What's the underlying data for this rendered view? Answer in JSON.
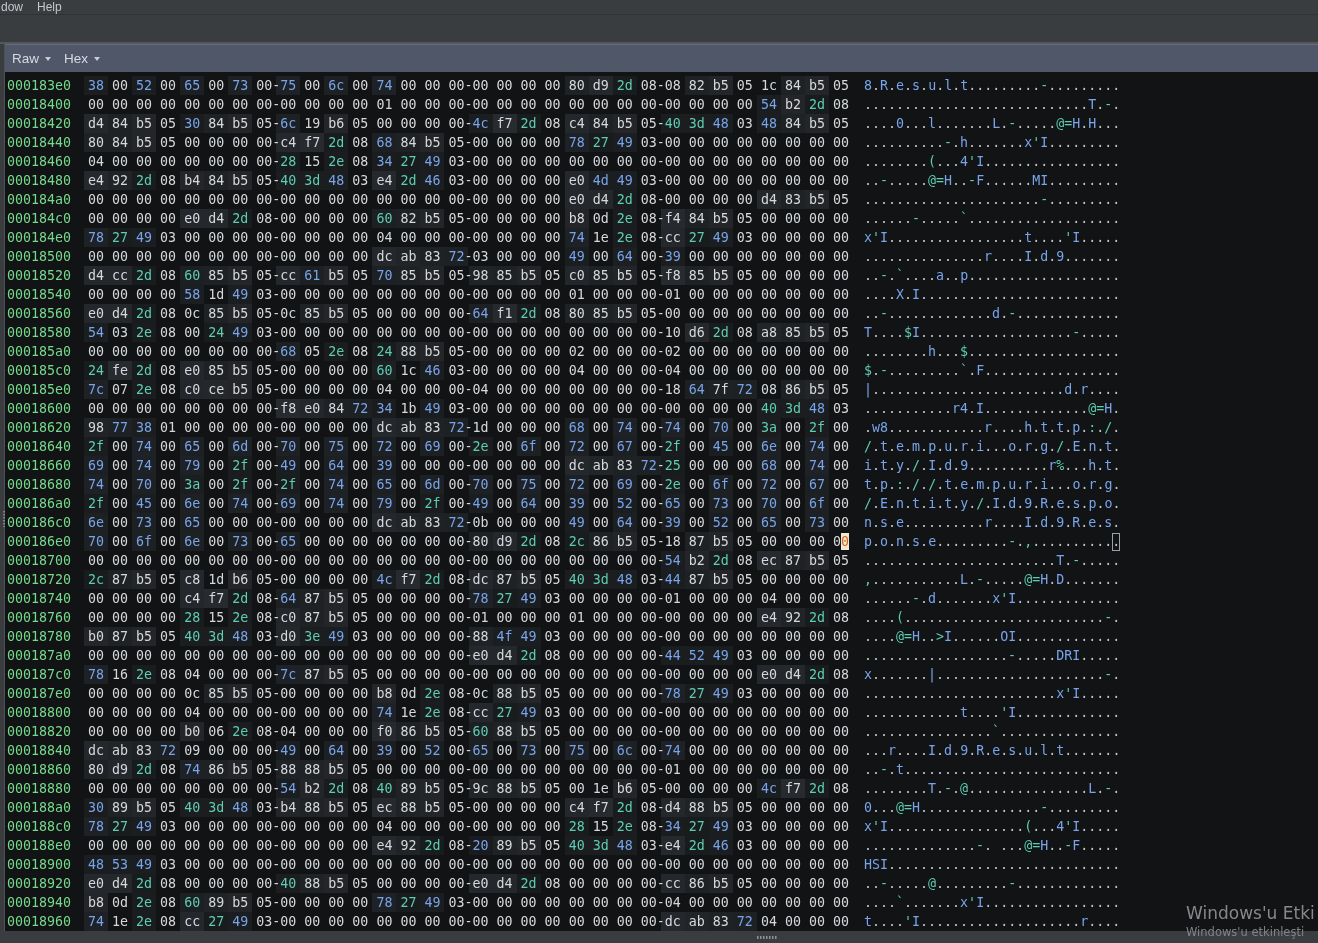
{
  "menu_bar": {
    "items": [
      {
        "label": "dow"
      },
      {
        "label": "Help"
      }
    ]
  },
  "view_toolbar": {
    "dropdowns": [
      {
        "label": "Raw"
      },
      {
        "label": "Hex"
      }
    ]
  },
  "hex_view": {
    "rows": [
      {
        "address": "000183e0",
        "hex": "38 00 52 00 65 00 73 00-75 00 6c 00 74 00 00 00-00 00 00 00 80 d9 2d 08-08 82 b5 05 1c 84 b5 05",
        "ascii": "8.R.e.s.u.l.t.........-.........",
        "cursor": false
      },
      {
        "address": "00018400",
        "hex": "00 00 00 00 00 00 00 00-00 00 00 00 01 00 00 00-00 00 00 00 00 00 00 00-00 00 00 00 54 b2 2d 08",
        "ascii": "............................T.-.",
        "cursor": false
      },
      {
        "address": "00018420",
        "hex": "d4 84 b5 05 30 84 b5 05-6c 19 b6 05 00 00 00 00-4c f7 2d 08 c4 84 b5 05-40 3d 48 03 48 84 b5 05",
        "ascii": "....0...l.......L.-.....@=H.H...",
        "cursor": false
      },
      {
        "address": "00018440",
        "hex": "80 84 b5 05 00 00 00 00-c4 f7 2d 08 68 84 b5 05-00 00 00 00 78 27 49 03-00 00 00 00 00 00 00 00",
        "ascii": "..........-.h.......x'I.........",
        "cursor": false
      },
      {
        "address": "00018460",
        "hex": "04 00 00 00 00 00 00 00-28 15 2e 08 34 27 49 03-00 00 00 00 00 00 00 00-00 00 00 00 00 00 00 00",
        "ascii": "........(...4'I.................",
        "cursor": false
      },
      {
        "address": "00018480",
        "hex": "e4 92 2d 08 b4 84 b5 05-40 3d 48 03 e4 2d 46 03-00 00 00 00 e0 4d 49 03-00 00 00 00 00 00 00 00",
        "ascii": "..-.....@=H..-F......MI.........",
        "cursor": false
      },
      {
        "address": "000184a0",
        "hex": "00 00 00 00 00 00 00 00-00 00 00 00 00 00 00 00-00 00 00 00 e0 d4 2d 08-00 00 00 00 d4 83 b5 05",
        "ascii": "......................-.........",
        "cursor": false
      },
      {
        "address": "000184c0",
        "hex": "00 00 00 00 e0 d4 2d 08-00 00 00 00 60 82 b5 05-00 00 00 00 b8 0d 2e 08-f4 84 b5 05 00 00 00 00",
        "ascii": "......-.....`...................",
        "cursor": false
      },
      {
        "address": "000184e0",
        "hex": "78 27 49 03 00 00 00 00-00 00 00 00 04 00 00 00-00 00 00 00 74 1e 2e 08-cc 27 49 03 00 00 00 00",
        "ascii": "x'I.................t....'I.....",
        "cursor": false
      },
      {
        "address": "00018500",
        "hex": "00 00 00 00 00 00 00 00-00 00 00 00 dc ab 83 72-03 00 00 00 49 00 64 00-39 00 00 00 00 00 00 00",
        "ascii": "...............r....I.d.9.......",
        "cursor": false
      },
      {
        "address": "00018520",
        "hex": "d4 cc 2d 08 60 85 b5 05-cc 61 b5 05 70 85 b5 05-98 85 b5 05 c0 85 b5 05-f8 85 b5 05 00 00 00 00",
        "ascii": "..-.`....a..p...................",
        "cursor": false
      },
      {
        "address": "00018540",
        "hex": "00 00 00 00 58 1d 49 03-00 00 00 00 00 00 00 00-00 00 00 00 01 00 00 00-01 00 00 00 00 00 00 00",
        "ascii": "....X.I.........................",
        "cursor": false
      },
      {
        "address": "00018560",
        "hex": "e0 d4 2d 08 0c 85 b5 05-0c 85 b5 05 00 00 00 00-64 f1 2d 08 80 85 b5 05-00 00 00 00 00 00 00 00",
        "ascii": "..-.............d.-.............",
        "cursor": false
      },
      {
        "address": "00018580",
        "hex": "54 03 2e 08 00 24 49 03-00 00 00 00 00 00 00 00-00 00 00 00 00 00 00 00-10 d6 2d 08 a8 85 b5 05",
        "ascii": "T....$I...................-.....",
        "cursor": false
      },
      {
        "address": "000185a0",
        "hex": "00 00 00 00 00 00 00 00-68 05 2e 08 24 88 b5 05-00 00 00 00 02 00 00 00-02 00 00 00 00 00 00 00",
        "ascii": "........h...$...................",
        "cursor": false
      },
      {
        "address": "000185c0",
        "hex": "24 fe 2d 08 e0 85 b5 05-00 00 00 00 60 1c 46 03-00 00 00 00 04 00 00 00-04 00 00 00 00 00 00 00",
        "ascii": "$.-.........`.F.................",
        "cursor": false
      },
      {
        "address": "000185e0",
        "hex": "7c 07 2e 08 c0 ce b5 05-00 00 00 00 04 00 00 00-04 00 00 00 00 00 00 00-18 64 7f 72 08 86 b5 05",
        "ascii": "|........................d.r....",
        "cursor": false
      },
      {
        "address": "00018600",
        "hex": "00 00 00 00 00 00 00 00-f8 e0 84 72 34 1b 49 03-00 00 00 00 00 00 00 00-00 00 00 00 40 3d 48 03",
        "ascii": "...........r4.I.............@=H.",
        "cursor": false
      },
      {
        "address": "00018620",
        "hex": "98 77 38 01 00 00 00 00-00 00 00 00 dc ab 83 72-1d 00 00 00 68 00 74 00-74 00 70 00 3a 00 2f 00",
        "ascii": ".w8............r....h.t.t.p.:./.",
        "cursor": false
      },
      {
        "address": "00018640",
        "hex": "2f 00 74 00 65 00 6d 00-70 00 75 00 72 00 69 00-2e 00 6f 00 72 00 67 00-2f 00 45 00 6e 00 74 00",
        "ascii": "/.t.e.m.p.u.r.i...o.r.g./.E.n.t.",
        "cursor": false
      },
      {
        "address": "00018660",
        "hex": "69 00 74 00 79 00 2f 00-49 00 64 00 39 00 00 00-00 00 00 00 dc ab 83 72-25 00 00 00 68 00 74 00",
        "ascii": "i.t.y./.I.d.9..........r%...h.t.",
        "cursor": false
      },
      {
        "address": "00018680",
        "hex": "74 00 70 00 3a 00 2f 00-2f 00 74 00 65 00 6d 00-70 00 75 00 72 00 69 00-2e 00 6f 00 72 00 67 00",
        "ascii": "t.p.:././.t.e.m.p.u.r.i...o.r.g.",
        "cursor": false
      },
      {
        "address": "000186a0",
        "hex": "2f 00 45 00 6e 00 74 00-69 00 74 00 79 00 2f 00-49 00 64 00 39 00 52 00-65 00 73 00 70 00 6f 00",
        "ascii": "/.E.n.t.i.t.y./.I.d.9.R.e.s.p.o.",
        "cursor": false
      },
      {
        "address": "000186c0",
        "hex": "6e 00 73 00 65 00 00 00-00 00 00 00 dc ab 83 72-0b 00 00 00 49 00 64 00-39 00 52 00 65 00 73 00",
        "ascii": "n.s.e..........r....I.d.9.R.e.s.",
        "cursor": false
      },
      {
        "address": "000186e0",
        "hex": "70 00 6f 00 6e 00 73 00-65 00 00 00 00 00 00 00-80 d9 2d 08 2c 86 b5 05-18 87 b5 05 00 00 00 00",
        "ascii": "p.o.n.s.e.........-.,...........",
        "cursor": true
      },
      {
        "address": "00018700",
        "hex": "00 00 00 00 00 00 00 00-00 00 00 00 00 00 00 00-00 00 00 00 00 00 00 00-54 b2 2d 08 ec 87 b5 05",
        "ascii": "........................T.-.....",
        "cursor": false
      },
      {
        "address": "00018720",
        "hex": "2c 87 b5 05 c8 1d b6 05-00 00 00 00 4c f7 2d 08-dc 87 b5 05 40 3d 48 03-44 87 b5 05 00 00 00 00",
        "ascii": ",...........L.-.....@=H.D.......",
        "cursor": false
      },
      {
        "address": "00018740",
        "hex": "00 00 00 00 c4 f7 2d 08-64 87 b5 05 00 00 00 00-78 27 49 03 00 00 00 00-01 00 00 00 04 00 00 00",
        "ascii": "......-.d.......x'I.............",
        "cursor": false
      },
      {
        "address": "00018760",
        "hex": "00 00 00 00 28 15 2e 08-c0 87 b5 05 00 00 00 00-01 00 00 00 01 00 00 00-00 00 00 00 e4 92 2d 08",
        "ascii": "....(.........................-.",
        "cursor": false
      },
      {
        "address": "00018780",
        "hex": "b0 87 b5 05 40 3d 48 03-d0 3e 49 03 00 00 00 00-88 4f 49 03 00 00 00 00-00 00 00 00 00 00 00 00",
        "ascii": "....@=H..>I......OI.............",
        "cursor": false
      },
      {
        "address": "000187a0",
        "hex": "00 00 00 00 00 00 00 00-00 00 00 00 00 00 00 00-e0 d4 2d 08 00 00 00 00-44 52 49 03 00 00 00 00",
        "ascii": "..................-.....DRI.....",
        "cursor": false
      },
      {
        "address": "000187c0",
        "hex": "78 16 2e 08 04 00 00 00-7c 87 b5 05 00 00 00 00-00 00 00 00 00 00 00 00-00 00 00 00 e0 d4 2d 08",
        "ascii": "x.......|.....................-.",
        "cursor": false
      },
      {
        "address": "000187e0",
        "hex": "00 00 00 00 0c 85 b5 05-00 00 00 00 b8 0d 2e 08-0c 88 b5 05 00 00 00 00-78 27 49 03 00 00 00 00",
        "ascii": "........................x'I.....",
        "cursor": false
      },
      {
        "address": "00018800",
        "hex": "00 00 00 00 04 00 00 00-00 00 00 00 74 1e 2e 08-cc 27 49 03 00 00 00 00-00 00 00 00 00 00 00 00",
        "ascii": "............t....'I.............",
        "cursor": false
      },
      {
        "address": "00018820",
        "hex": "00 00 00 00 b0 06 2e 08-04 00 00 00 f0 86 b5 05-60 88 b5 05 00 00 00 00-00 00 00 00 00 00 00 00",
        "ascii": "................`...............",
        "cursor": false
      },
      {
        "address": "00018840",
        "hex": "dc ab 83 72 09 00 00 00-49 00 64 00 39 00 52 00-65 00 73 00 75 00 6c 00-74 00 00 00 00 00 00 00",
        "ascii": "...r....I.d.9.R.e.s.u.l.t.......",
        "cursor": false
      },
      {
        "address": "00018860",
        "hex": "80 d9 2d 08 74 86 b5 05-88 88 b5 05 00 00 00 00-00 00 00 00 00 00 00 00-01 00 00 00 00 00 00 00",
        "ascii": "..-.t...........................",
        "cursor": false
      },
      {
        "address": "00018880",
        "hex": "00 00 00 00 00 00 00 00-54 b2 2d 08 40 89 b5 05-9c 88 b5 05 00 1e b6 05-00 00 00 00 4c f7 2d 08",
        "ascii": "........T.-.@...............L.-.",
        "cursor": false
      },
      {
        "address": "000188a0",
        "hex": "30 89 b5 05 40 3d 48 03-b4 88 b5 05 ec 88 b5 05-00 00 00 00 c4 f7 2d 08-d4 88 b5 05 00 00 00 00",
        "ascii": "0...@=H...............-.........",
        "cursor": false
      },
      {
        "address": "000188c0",
        "hex": "78 27 49 03 00 00 00 00-00 00 00 00 04 00 00 00-00 00 00 00 28 15 2e 08-34 27 49 03 00 00 00 00",
        "ascii": "x'I.................(...4'I.....",
        "cursor": false
      },
      {
        "address": "000188e0",
        "hex": "00 00 00 00 00 00 00 00-00 00 00 00 e4 92 2d 08-20 89 b5 05 40 3d 48 03-e4 2d 46 03 00 00 00 00",
        "ascii": "..............-. ...@=H..-F.....",
        "cursor": false
      },
      {
        "address": "00018900",
        "hex": "48 53 49 03 00 00 00 00-00 00 00 00 00 00 00 00-00 00 00 00 00 00 00 00-00 00 00 00 00 00 00 00",
        "ascii": "HSI.............................",
        "cursor": false
      },
      {
        "address": "00018920",
        "hex": "e0 d4 2d 08 00 00 00 00-40 88 b5 05 00 00 00 00-e0 d4 2d 08 00 00 00 00-cc 86 b5 05 00 00 00 00",
        "ascii": "..-.....@.........-.............",
        "cursor": false
      },
      {
        "address": "00018940",
        "hex": "b8 0d 2e 08 60 89 b5 05-00 00 00 00 78 27 49 03-00 00 00 00 00 00 00 00-04 00 00 00 00 00 00 00",
        "ascii": "....`.......x'I.................",
        "cursor": false
      },
      {
        "address": "00018960",
        "hex": "74 1e 2e 08 cc 27 49 03-00 00 00 00 00 00 00 00-00 00 00 00 00 00 00 00-dc ab 83 72 04 00 00 00",
        "ascii": "t....'I....................r....",
        "cursor": false
      }
    ]
  },
  "activation_notice": {
    "title": "Windows'u Etki",
    "text": "Windows'u etkinleşti"
  }
}
